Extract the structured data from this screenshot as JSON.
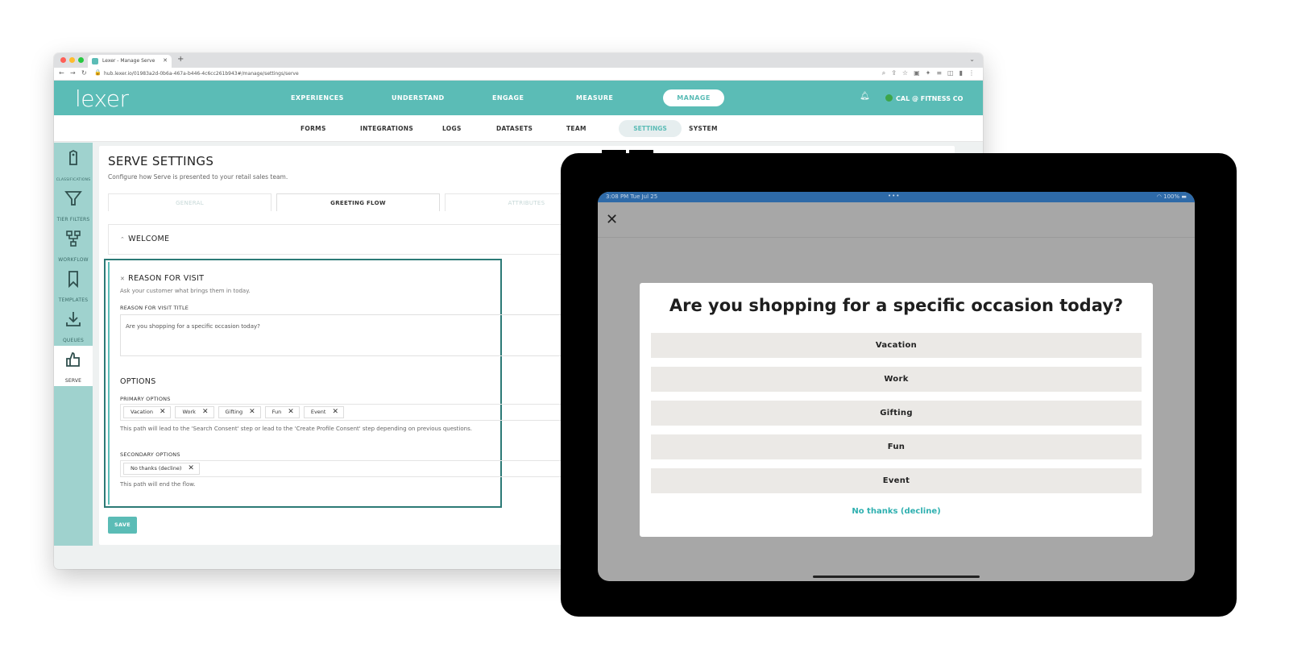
{
  "browser": {
    "tab_title": "Lexer - Manage Serve",
    "url": "hub.lexer.io/01983a2d-0b6a-467a-b446-4c6cc261b943#/manage/settings/serve"
  },
  "app": {
    "logo": "lexer",
    "nav": [
      "EXPERIENCES",
      "UNDERSTAND",
      "ENGAGE",
      "MEASURE"
    ],
    "nav_active": "MANAGE",
    "org": "CAL @ FITNESS CO",
    "subnav": [
      "FORMS",
      "INTEGRATIONS",
      "LOGS",
      "DATASETS",
      "TEAM"
    ],
    "subnav_active": "SETTINGS",
    "subnav_last": "SYSTEM"
  },
  "sidebar": {
    "items": [
      {
        "label": "CLASSIFICATIONS",
        "icon": "tag-icon"
      },
      {
        "label": "TIER FILTERS",
        "icon": "filter-icon"
      },
      {
        "label": "WORKFLOW",
        "icon": "workflow-icon"
      },
      {
        "label": "TEMPLATES",
        "icon": "bookmark-icon"
      },
      {
        "label": "QUEUES",
        "icon": "download-icon"
      },
      {
        "label": "SERVE",
        "icon": "serve-icon"
      }
    ]
  },
  "page": {
    "title": "SERVE SETTINGS",
    "subtitle": "Configure how Serve is presented to your retail sales team.",
    "tabs": [
      "GENERAL",
      "GREETING FLOW",
      "ATTRIBUTES"
    ],
    "welcome": "WELCOME",
    "reason": {
      "title": "REASON FOR VISIT",
      "subtitle": "Ask your customer what brings them in today.",
      "field_label": "REASON FOR VISIT TITLE",
      "field_value": "Are you shopping for a specific occasion today?",
      "options_heading": "OPTIONS",
      "primary_label": "PRIMARY OPTIONS",
      "primary_chips": [
        "Vacation",
        "Work",
        "Gifting",
        "Fun",
        "Event"
      ],
      "primary_note": "This path will lead to the 'Search Consent' step or lead to the 'Create Profile Consent' step depending on previous questions.",
      "secondary_label": "SECONDARY OPTIONS",
      "secondary_chips": [
        "No thanks (decline)"
      ],
      "secondary_note": "This path will end the flow."
    },
    "save": "SAVE"
  },
  "tablet": {
    "time": "3:08 PM  Tue Jul 25",
    "battery": "100%",
    "question": "Are you shopping for a specific occasion today?",
    "options": [
      "Vacation",
      "Work",
      "Gifting",
      "Fun",
      "Event"
    ],
    "decline": "No thanks (decline)"
  },
  "colors": {
    "brand": "#5bbcb6",
    "sidebar": "#9fd2ce",
    "accent_link": "#2fb0b0"
  }
}
